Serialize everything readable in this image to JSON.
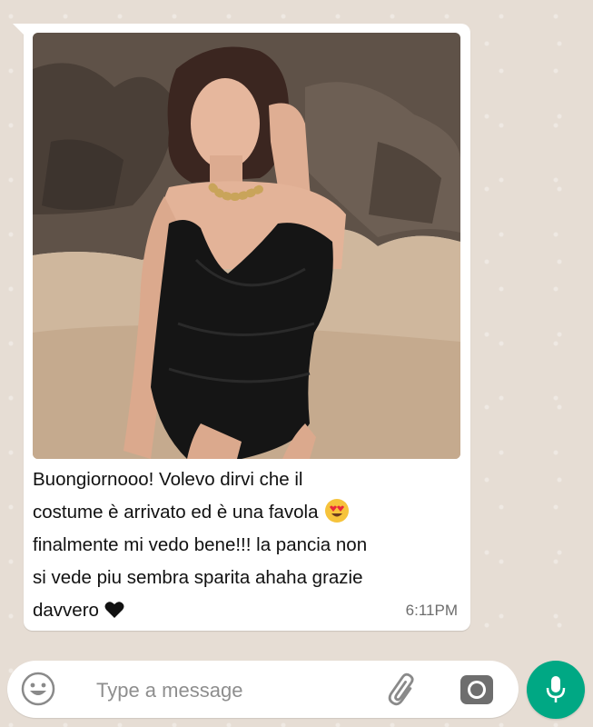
{
  "message": {
    "caption_line1": "Buongiornooo! Volevo dirvi che il",
    "caption_line2": "costume è arrivato ed è una favola",
    "caption_line3": "finalmente mi vedo bene!!! la pancia non",
    "caption_line4": "si vede piu sembra sparita ahaha grazie",
    "caption_line5": "davvero",
    "timestamp": "6:11PM",
    "photo_icon": "photo-woman-black-swimsuit-beach",
    "emoji": "smiling-face-heart-eyes",
    "end_icon": "black-heart-icon"
  },
  "composer": {
    "placeholder": "Type a message",
    "value": ""
  },
  "icons": {
    "emoji": "smiley-icon",
    "attach": "paperclip-icon",
    "camera": "camera-icon",
    "mic": "microphone-icon"
  },
  "colors": {
    "chat_background": "#e6ddd4",
    "bubble": "#ffffff",
    "accent_green": "#00a884",
    "timestamp": "#6d6d6d"
  }
}
